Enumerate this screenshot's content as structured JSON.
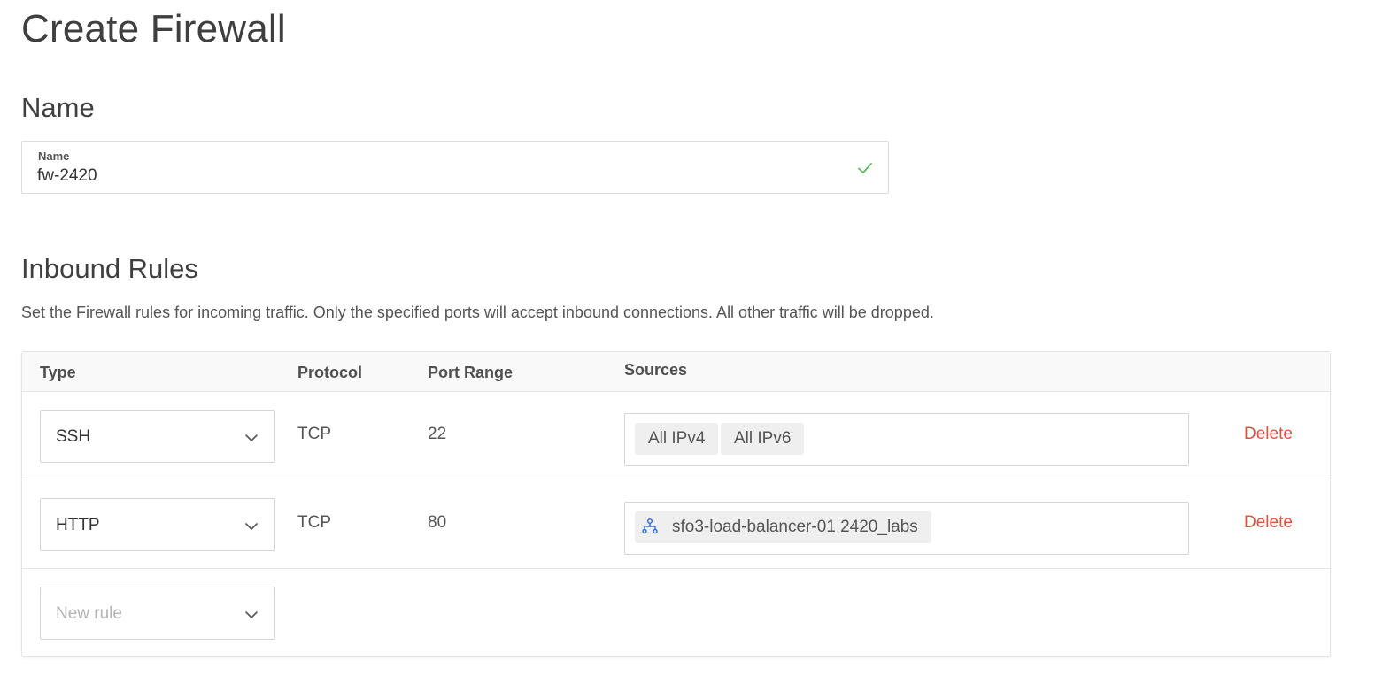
{
  "page": {
    "title": "Create Firewall"
  },
  "name_section": {
    "heading": "Name",
    "field_label": "Name",
    "field_value": "fw-2420",
    "status_icon": "check-icon",
    "status_color": "#5cb85c"
  },
  "inbound": {
    "heading": "Inbound Rules",
    "description": "Set the Firewall rules for incoming traffic. Only the specified ports will accept inbound connections. All other traffic will be dropped.",
    "columns": {
      "type": "Type",
      "protocol": "Protocol",
      "port_range": "Port Range",
      "sources": "Sources"
    },
    "rules": [
      {
        "type": "SSH",
        "protocol": "TCP",
        "port_range": "22",
        "sources": [
          "All IPv4",
          "All IPv6"
        ],
        "delete_label": "Delete"
      },
      {
        "type": "HTTP",
        "protocol": "TCP",
        "port_range": "80",
        "sources": [
          "sfo3-load-balancer-01 2420_labs"
        ],
        "source_icon": "load-balancer-icon",
        "delete_label": "Delete"
      }
    ],
    "new_rule_placeholder": "New rule"
  },
  "colors": {
    "delete": "#d9533f",
    "load_balancer_icon": "#3b6fd6"
  }
}
